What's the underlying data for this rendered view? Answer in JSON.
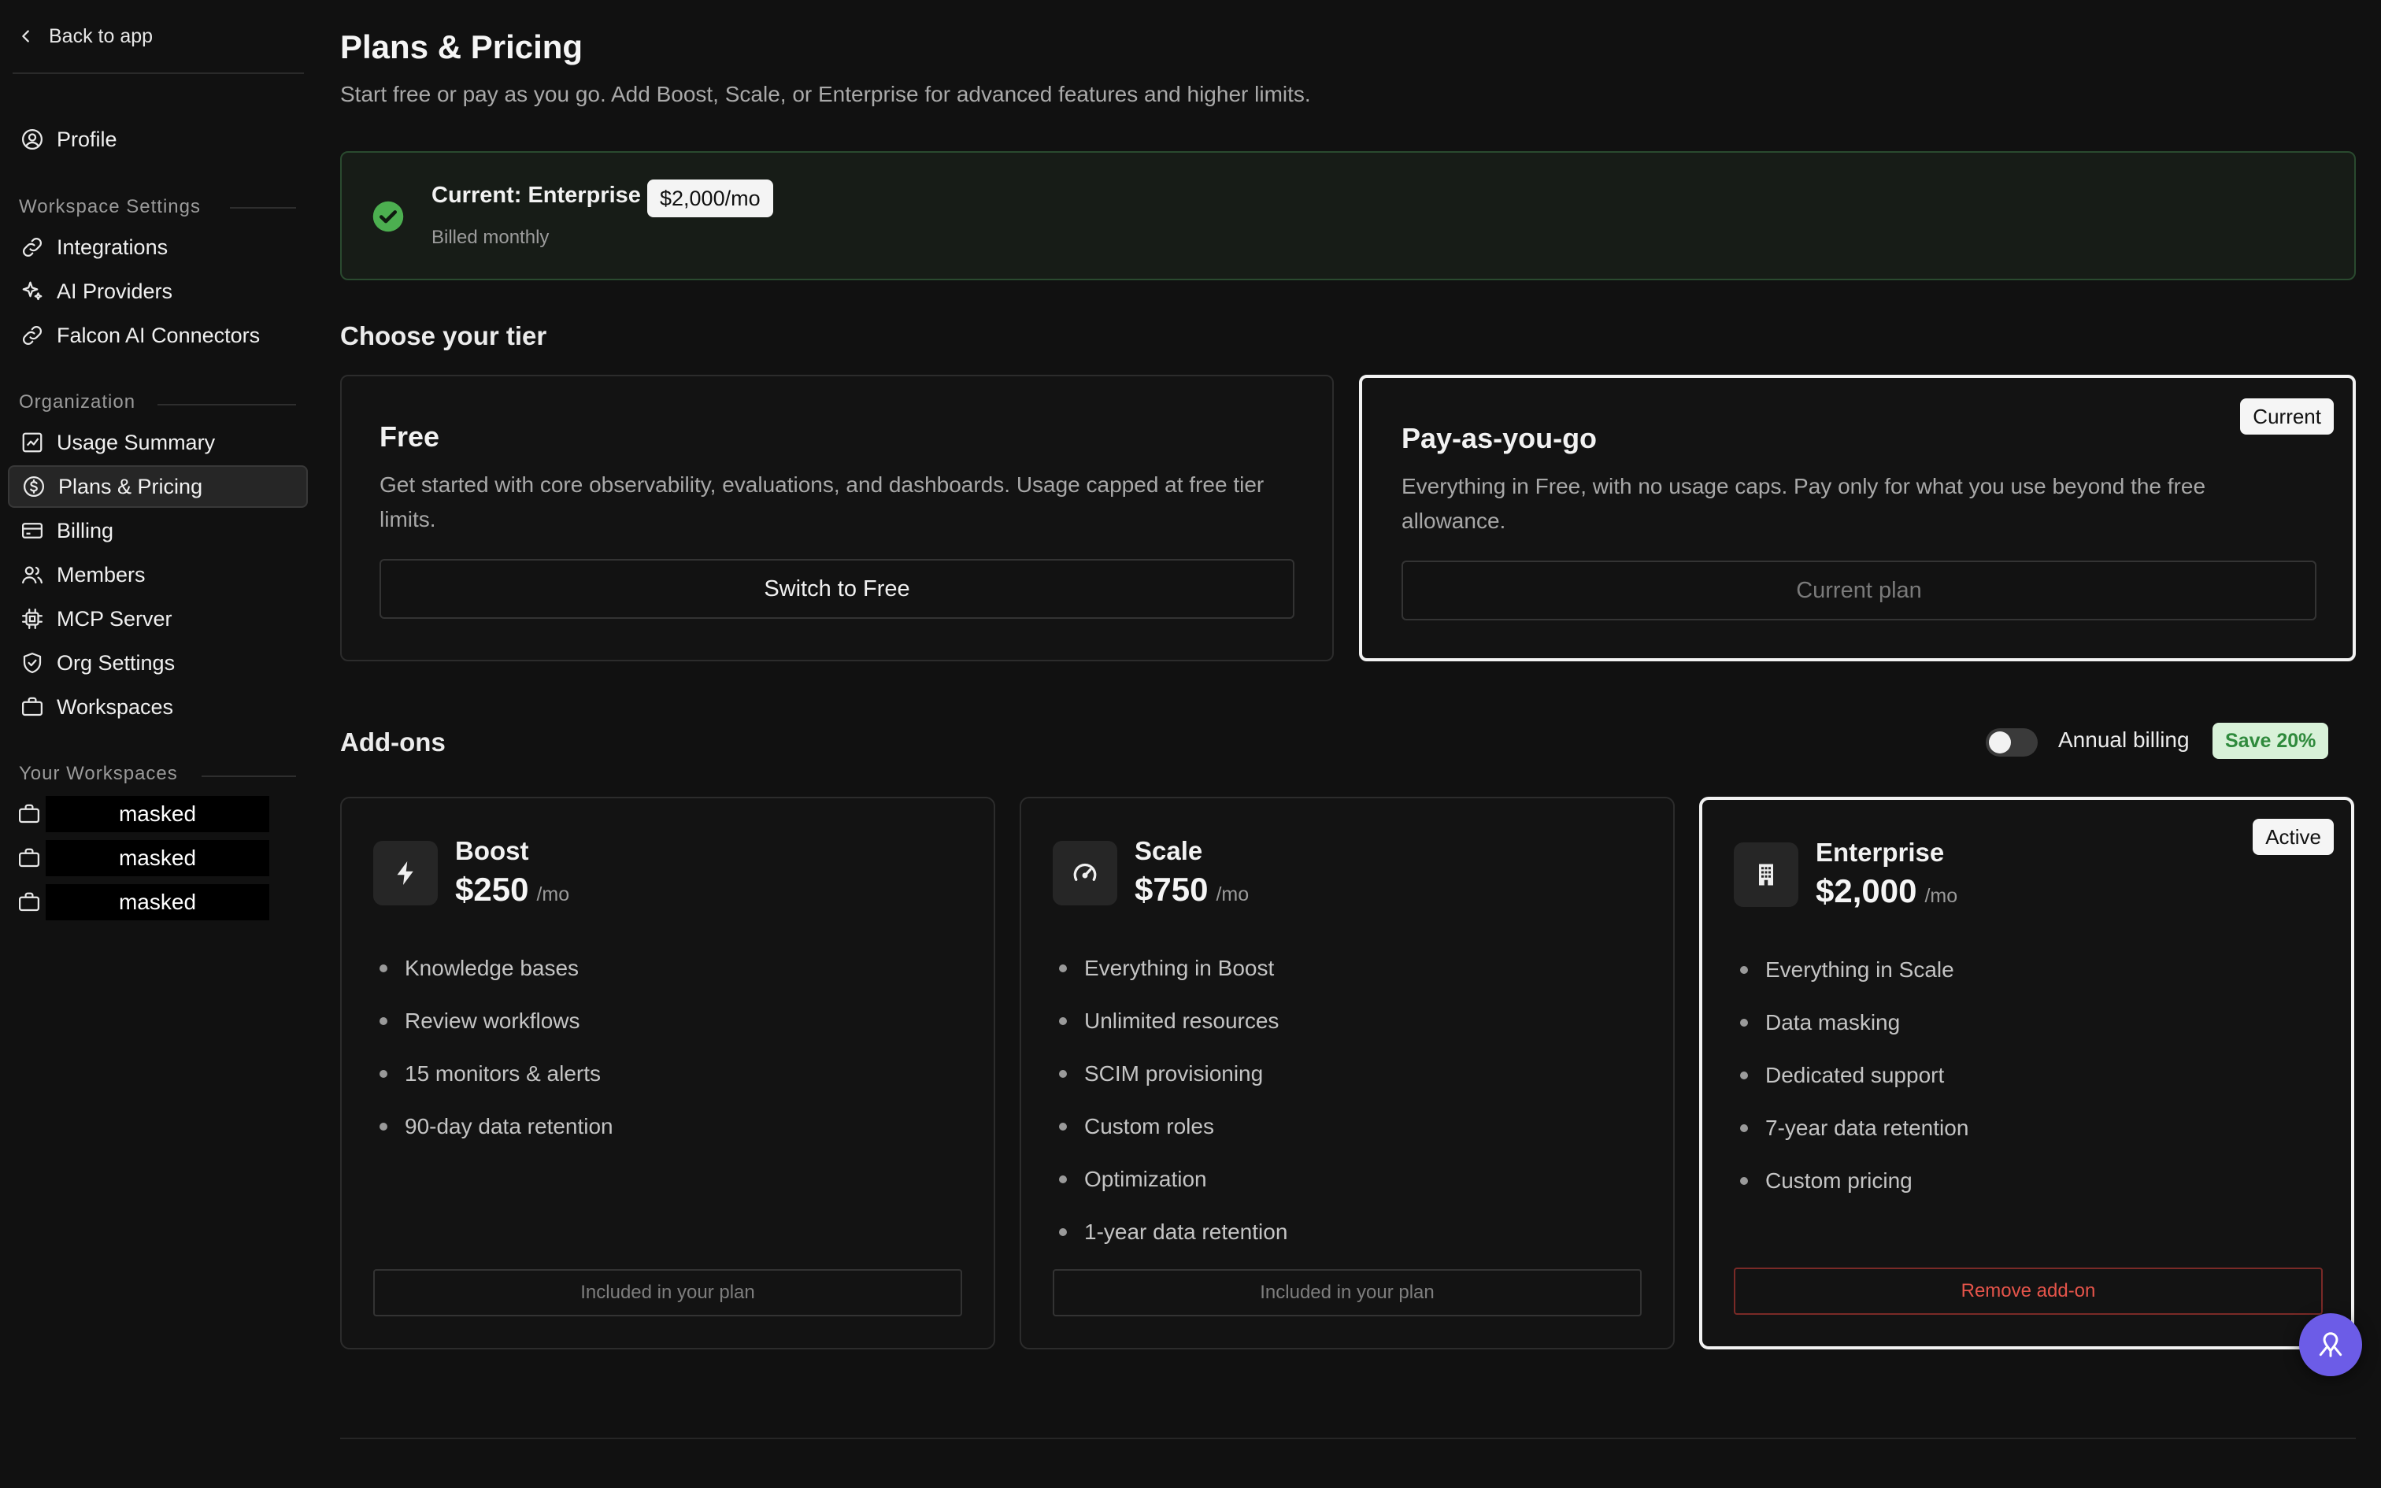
{
  "sidebar": {
    "back_label": "Back to app",
    "profile_label": "Profile",
    "workspace_settings_label": "Workspace Settings",
    "workspace_items": [
      {
        "label": "Integrations",
        "icon": "link-icon"
      },
      {
        "label": "AI Providers",
        "icon": "sparkle-icon"
      },
      {
        "label": "Falcon AI Connectors",
        "icon": "link-icon"
      }
    ],
    "organization_label": "Organization",
    "organization_items": [
      {
        "label": "Usage Summary",
        "icon": "chart-icon"
      },
      {
        "label": "Plans & Pricing",
        "icon": "dollar-circle-icon",
        "active": true
      },
      {
        "label": "Billing",
        "icon": "credit-card-icon"
      },
      {
        "label": "Members",
        "icon": "users-icon"
      },
      {
        "label": "MCP Server",
        "icon": "chip-icon"
      },
      {
        "label": "Org Settings",
        "icon": "shield-icon"
      },
      {
        "label": "Workspaces",
        "icon": "briefcase-icon"
      }
    ],
    "your_workspaces_label": "Your Workspaces",
    "your_workspaces": [
      "masked",
      "masked",
      "masked"
    ]
  },
  "header": {
    "title": "Plans & Pricing",
    "subtitle": "Start free or pay as you go. Add Boost, Scale, or Enterprise for advanced features and higher limits."
  },
  "current_plan": {
    "title": "Current: Enterprise",
    "price": "$2,000/mo",
    "billing": "Billed monthly"
  },
  "tiers_heading": "Choose your tier",
  "tiers": [
    {
      "name": "Free",
      "description": "Get started with core observability, evaluations, and dashboards. Usage capped at free tier limits.",
      "button": "Switch to Free"
    },
    {
      "name": "Pay-as-you-go",
      "description": "Everything in Free, with no usage caps. Pay only for what you use beyond the free allowance.",
      "button": "Current plan",
      "badge": "Current"
    }
  ],
  "addons_heading": "Add-ons",
  "annual_billing": {
    "label": "Annual billing",
    "save_badge": "Save 20%",
    "enabled": false
  },
  "addons": [
    {
      "name": "Boost",
      "price": "$250",
      "period": "/mo",
      "icon": "lightning-icon",
      "features": [
        "Knowledge bases",
        "Review workflows",
        "15 monitors & alerts",
        "90-day data retention"
      ],
      "button": "Included in your plan"
    },
    {
      "name": "Scale",
      "price": "$750",
      "period": "/mo",
      "icon": "gauge-icon",
      "features": [
        "Everything in Boost",
        "Unlimited resources",
        "SCIM provisioning",
        "Custom roles",
        "Optimization",
        "1-year data retention"
      ],
      "button": "Included in your plan"
    },
    {
      "name": "Enterprise",
      "price": "$2,000",
      "period": "/mo",
      "icon": "building-icon",
      "badge": "Active",
      "features": [
        "Everything in Scale",
        "Data masking",
        "Dedicated support",
        "7-year data retention",
        "Custom pricing"
      ],
      "button": "Remove add-on"
    }
  ],
  "colors": {
    "background": "#111111",
    "success": "#4caf50",
    "danger": "#e5544a",
    "fab": "#6c5ce7"
  }
}
